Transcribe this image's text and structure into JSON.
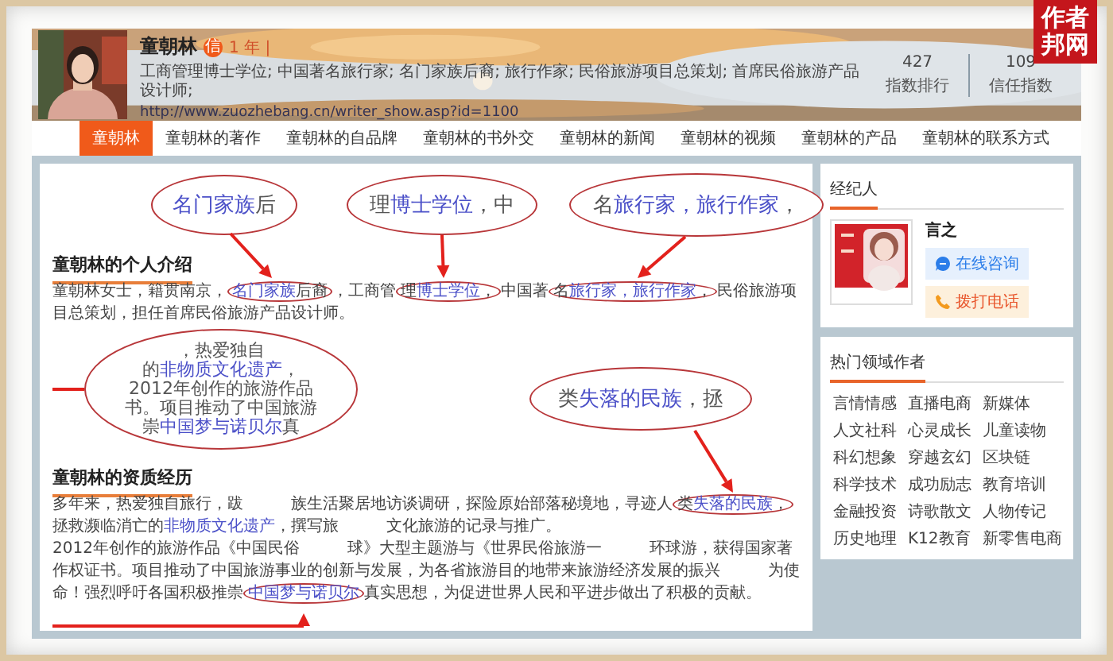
{
  "logo": {
    "lines": [
      "作者",
      "邦网"
    ]
  },
  "profile": {
    "name": "童朝林",
    "badge": "信",
    "years": "1 年 |",
    "description": "工商管理博士学位; 中国著名旅行家; 名门家族后裔; 旅行作家; 民俗旅游项目总策划; 首席民俗旅游产品设计师;",
    "url": "http://www.zuozhebang.cn/writer_show.asp?id=1100",
    "stats": [
      {
        "value": "427",
        "label": "指数排行"
      },
      {
        "value": "109",
        "label": "信任指数"
      }
    ]
  },
  "nav": [
    {
      "label": "童朝林",
      "selected": true
    },
    {
      "label": "童朝林的著作",
      "selected": false
    },
    {
      "label": "童朝林的自品牌",
      "selected": false
    },
    {
      "label": "童朝林的书外交",
      "selected": false
    },
    {
      "label": "童朝林的新闻",
      "selected": false
    },
    {
      "label": "童朝林的视频",
      "selected": false
    },
    {
      "label": "童朝林的产品",
      "selected": false
    },
    {
      "label": "童朝林的联系方式",
      "selected": false
    }
  ],
  "callouts": [
    {
      "lines": [
        [
          {
            "text": "名门家族",
            "link": true
          },
          {
            "text": "后",
            "link": false
          }
        ]
      ]
    },
    {
      "lines": [
        [
          {
            "text": "理",
            "link": false
          },
          {
            "text": "博士学位",
            "link": true
          },
          {
            "text": "，中",
            "link": false
          }
        ]
      ]
    },
    {
      "lines": [
        [
          {
            "text": "名",
            "link": false
          },
          {
            "text": "旅行家，旅行作家",
            "link": true
          },
          {
            "text": "，",
            "link": false
          }
        ]
      ]
    },
    {
      "lines": [
        [
          {
            "text": "，热爱独自",
            "link": false
          }
        ],
        [
          {
            "text": "的",
            "link": false
          },
          {
            "text": "非物质文化遗产",
            "link": true
          },
          {
            "text": "，",
            "link": false
          }
        ],
        [
          {
            "text": "2012年创作的旅游作品",
            "link": false
          }
        ],
        [
          {
            "text": "书。项目推动了中国旅游",
            "link": false
          }
        ],
        [
          {
            "text": "崇",
            "link": false
          },
          {
            "text": "中国梦与诺贝尔",
            "link": true
          },
          {
            "text": "真",
            "link": false
          }
        ]
      ]
    },
    {
      "lines": [
        [
          {
            "text": "类",
            "link": false
          },
          {
            "text": "失落的民族",
            "link": true
          },
          {
            "text": "，拯",
            "link": false
          }
        ]
      ]
    }
  ],
  "sections": [
    {
      "title": "童朝林的个人介绍",
      "paragraphs": [
        [
          {
            "kind": "text",
            "text": "童朝林女士，籍贯南京，"
          },
          {
            "kind": "circled",
            "parts": [
              {
                "kind": "link",
                "text": "名门家族"
              },
              {
                "kind": "text",
                "text": "后裔"
              }
            ]
          },
          {
            "kind": "text",
            "text": "，工商管"
          },
          {
            "kind": "circled",
            "parts": [
              {
                "kind": "text",
                "text": "理"
              },
              {
                "kind": "link",
                "text": "博士学位"
              },
              {
                "kind": "text",
                "text": "，"
              }
            ]
          },
          {
            "kind": "text",
            "text": "中国著"
          },
          {
            "kind": "circled",
            "parts": [
              {
                "kind": "text",
                "text": "名"
              },
              {
                "kind": "link",
                "text": "旅行家，旅行作家"
              },
              {
                "kind": "text",
                "text": "，"
              }
            ]
          },
          {
            "kind": "text",
            "text": "民俗旅游项目总策划，担任首席民俗旅游产品设计师。"
          }
        ]
      ]
    },
    {
      "title": "童朝林的资质经历",
      "paragraphs": [
        [
          {
            "kind": "text",
            "text": "多年来，热爱独自旅行，跋"
          },
          {
            "kind": "covered"
          },
          {
            "kind": "text",
            "text": "族生活聚居地访谈调研，探险原始部落秘境地，寻迹人"
          },
          {
            "kind": "circled",
            "parts": [
              {
                "kind": "text",
                "text": "类"
              },
              {
                "kind": "link",
                "text": "失落的民族"
              },
              {
                "kind": "text",
                "text": "，"
              }
            ]
          },
          {
            "kind": "text",
            "text": "拯救濒临消亡的"
          },
          {
            "kind": "link",
            "text": "非物质文化遗产"
          },
          {
            "kind": "text",
            "text": "，撰写旅"
          },
          {
            "kind": "covered"
          },
          {
            "kind": "text",
            "text": "文化旅游的记录与推广。"
          }
        ],
        [
          {
            "kind": "text",
            "text": "2012年创作的旅游作品《中国民俗"
          },
          {
            "kind": "covered"
          },
          {
            "kind": "text",
            "text": "球》大型主题游与《世界民俗旅游一"
          },
          {
            "kind": "covered"
          },
          {
            "kind": "text",
            "text": "环球游，获得国家著作权证书。项目推动了中国旅游事业的创新与发展，为各省旅游目的地带来旅游经济发展的振兴"
          },
          {
            "kind": "covered"
          },
          {
            "kind": "text",
            "text": "为使命！强烈呼吁各国积极推崇"
          },
          {
            "kind": "circled",
            "parts": [
              {
                "kind": "link",
                "text": "中国梦与诺贝尔"
              }
            ]
          },
          {
            "kind": "text",
            "text": "真实思想，为促进世界人民和平进步做出了积极的贡献。"
          }
        ]
      ]
    }
  ],
  "agent": {
    "title": "经纪人",
    "name": "言之",
    "buttons": [
      {
        "label": "在线咨询",
        "kind": "chat"
      },
      {
        "label": "拨打电话",
        "kind": "phone"
      }
    ]
  },
  "hot": {
    "title": "热门领域作者",
    "tags": [
      "言情情感",
      "直播电商",
      "新媒体",
      "人文社科",
      "心灵成长",
      "儿童读物",
      "科幻想象",
      "穿越玄幻",
      "区块链",
      "科学技术",
      "成功励志",
      "教育培训",
      "金融投资",
      "诗歌散文",
      "人物传记",
      "历史地理",
      "K12教育",
      "新零售电商"
    ]
  }
}
